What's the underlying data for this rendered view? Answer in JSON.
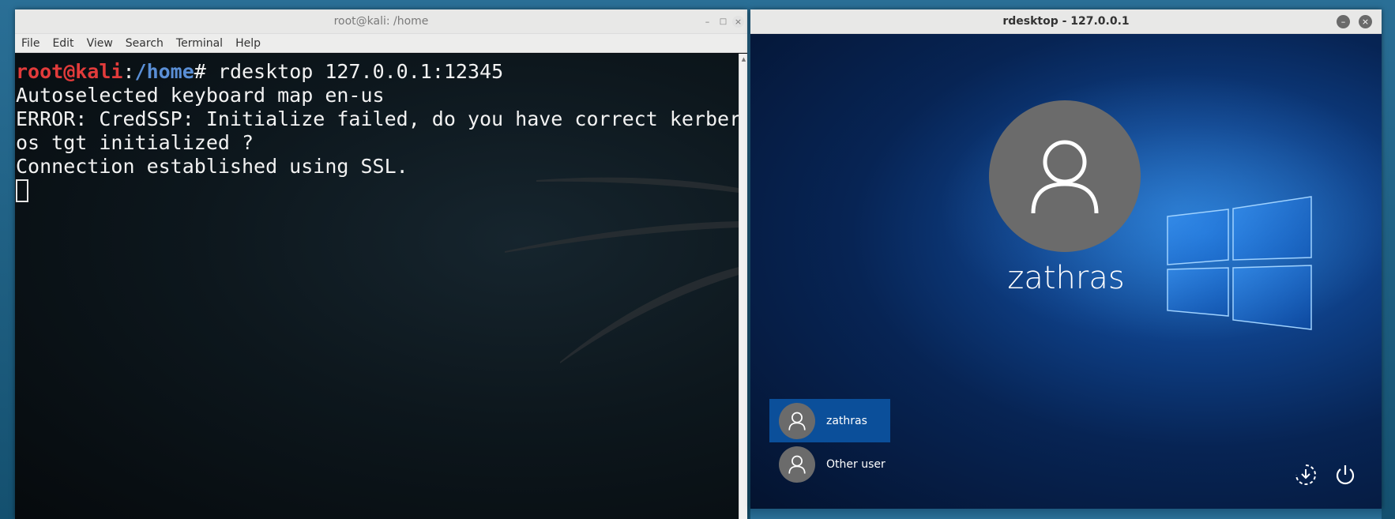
{
  "terminal": {
    "title": "root@kali: /home",
    "menu": [
      "File",
      "Edit",
      "View",
      "Search",
      "Terminal",
      "Help"
    ],
    "prompt_user": "root@kali",
    "prompt_colon": ":",
    "prompt_path": "/home",
    "prompt_hash": "# ",
    "command": "rdesktop 127.0.0.1:12345",
    "output": [
      "Autoselected keyboard map en-us",
      "ERROR: CredSSP: Initialize failed, do you have correct kerber",
      "os tgt initialized ?",
      "Connection established using SSL."
    ],
    "window_buttons": {
      "minimize": "–",
      "maximize": "□",
      "close": "×"
    }
  },
  "rdesktop": {
    "title": "rdesktop - 127.0.0.1",
    "window_buttons": {
      "minimize": "–",
      "close": "×"
    },
    "login": {
      "selected_user": "zathras",
      "users": [
        {
          "label": "zathras",
          "selected": true
        },
        {
          "label": "Other user",
          "selected": false
        }
      ]
    },
    "icons": [
      "ease-of-access-icon",
      "power-icon"
    ]
  },
  "colors": {
    "prompt_user": "#e23b3b",
    "prompt_path": "#5a8fd6",
    "selected_tile": "#0b4f9a"
  }
}
